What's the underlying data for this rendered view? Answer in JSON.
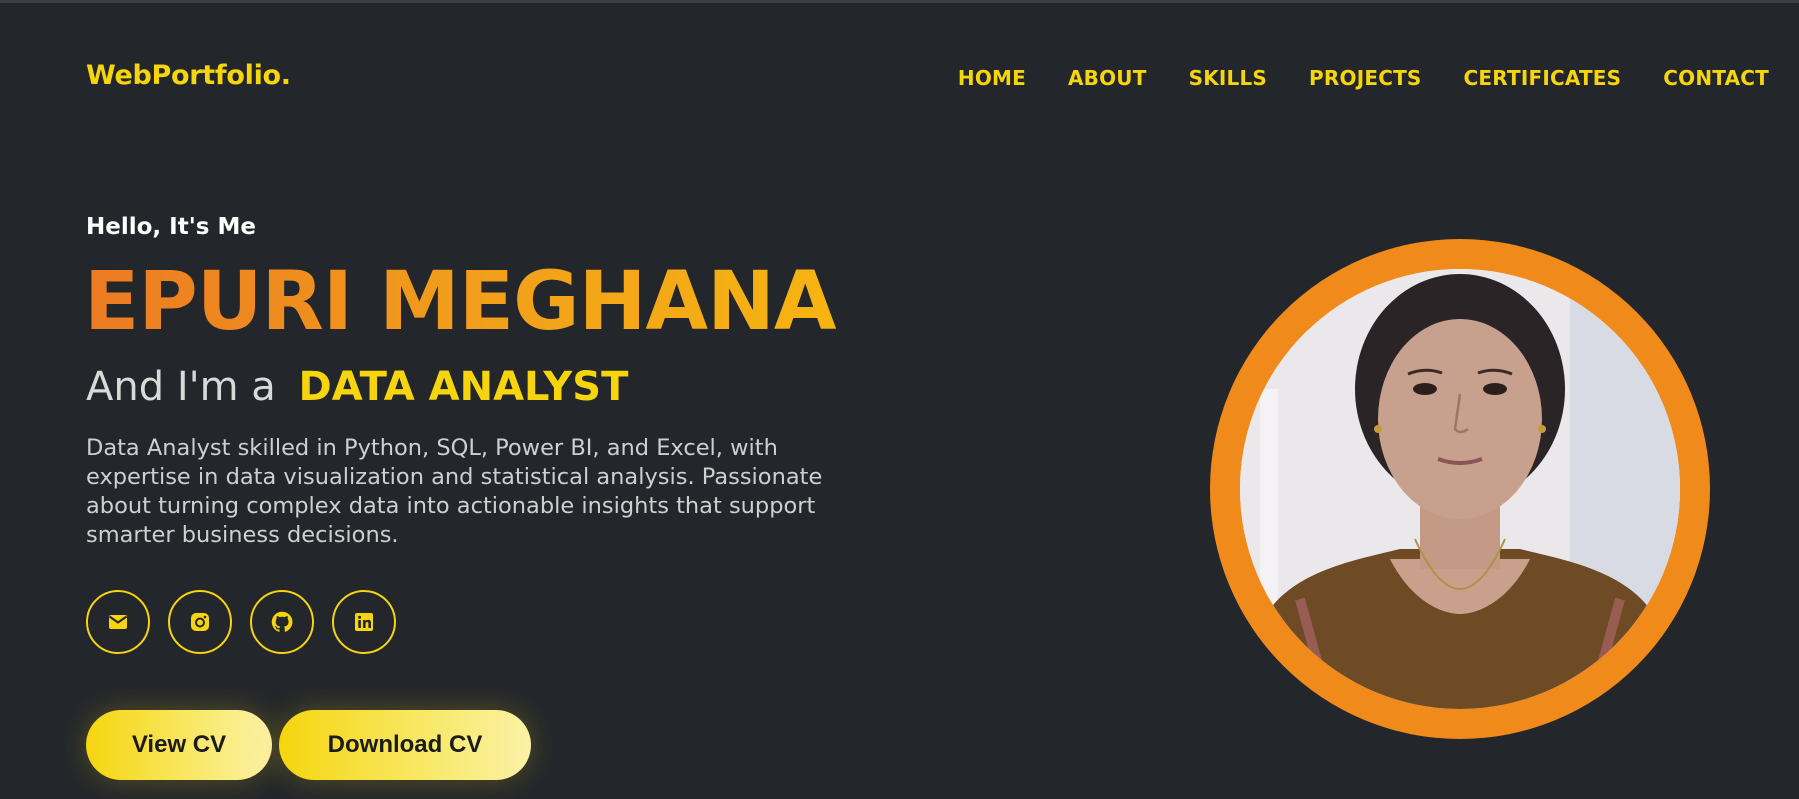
{
  "header": {
    "logo": "WebPortfolio.",
    "nav": [
      "HOME",
      "ABOUT",
      "SKILLS",
      "PROJECTS",
      "CERTIFICATES",
      "CONTACT"
    ]
  },
  "hero": {
    "greeting": "Hello, It's Me",
    "name": "EPURI MEGHANA",
    "role_prefix": "And I'm a",
    "role": "DATA ANALYST",
    "description": "Data Analyst skilled in Python, SQL, Power BI, and Excel, with expertise in data visualization and statistical analysis. Passionate about turning complex data into actionable insights that support smarter business decisions.",
    "socials": [
      "mail-icon",
      "instagram-icon",
      "github-icon",
      "linkedin-icon"
    ],
    "buttons": {
      "view_cv": "View CV",
      "download_cv": "Download CV"
    }
  },
  "colors": {
    "background": "#23262b",
    "accent_yellow": "#f6d50e",
    "accent_orange": "#ef8a1b"
  }
}
